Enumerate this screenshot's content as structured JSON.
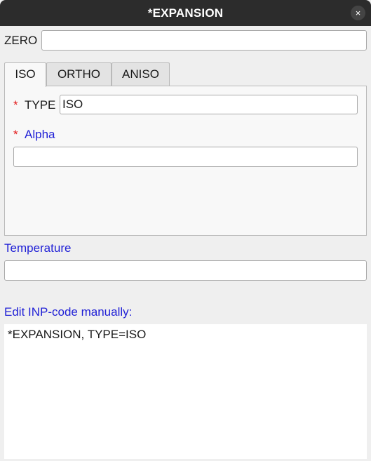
{
  "window": {
    "title": "*EXPANSION",
    "close_icon": "×"
  },
  "zero": {
    "label": "ZERO",
    "value": ""
  },
  "tabs": [
    {
      "label": "ISO",
      "active": true
    },
    {
      "label": "ORTHO",
      "active": false
    },
    {
      "label": "ANISO",
      "active": false
    }
  ],
  "iso_panel": {
    "type": {
      "required_mark": "*",
      "label": "TYPE",
      "value": "ISO"
    },
    "alpha": {
      "required_mark": "*",
      "label": "Alpha",
      "value": ""
    }
  },
  "temperature": {
    "label": "Temperature",
    "value": ""
  },
  "inp_code": {
    "label": "Edit INP-code manually:",
    "value": "*EXPANSION, TYPE=ISO"
  },
  "colors": {
    "titlebar": "#2c2c2c",
    "link_label": "#1f1fd6",
    "required": "#e31a1a"
  }
}
